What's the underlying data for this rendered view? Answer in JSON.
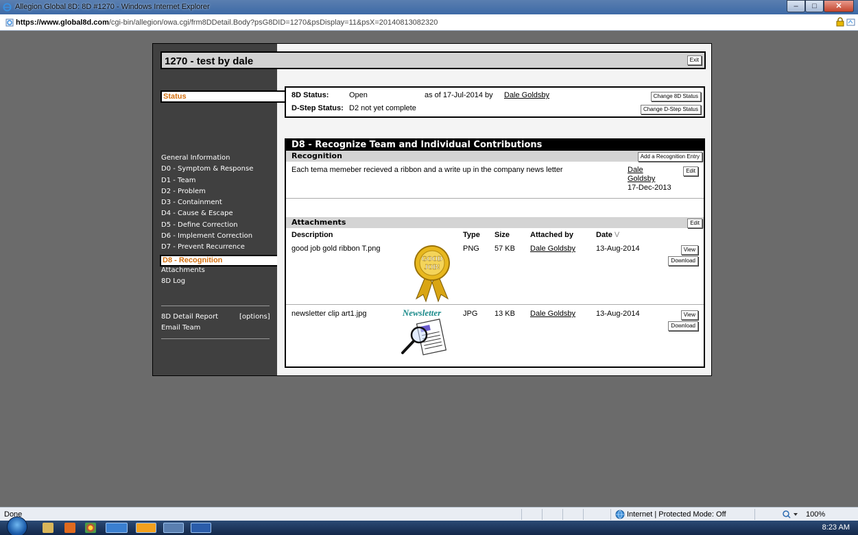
{
  "window": {
    "title": "Allegion Global 8D: 8D #1270 - Windows Internet Explorer",
    "url_host": "https://www.global8d.com",
    "url_path": "/cgi-bin/allegion/owa.cgi/frm8DDetail.Body?psG8DID=1270&psDisplay=11&psX=20140813082320"
  },
  "header": {
    "title": "1270 - test by dale",
    "exit_label": "Exit"
  },
  "status": {
    "tab_label": "Status",
    "status_label": "8D Status:",
    "status_value": "Open",
    "as_of": "as of 17-Jul-2014 by",
    "by_user": "Dale Goldsby",
    "dstep_label": "D-Step Status:",
    "dstep_value": "D2 not yet complete",
    "change_8d_label": "Change 8D Status",
    "change_dstep_label": "Change D-Step Status"
  },
  "nav": {
    "items": [
      "General Information",
      "D0 - Symptom & Response",
      "D1 - Team",
      "D2 - Problem",
      "D3 - Containment",
      "D4 - Cause & Escape",
      "D5 - Define Correction",
      "D6 - Implement Correction",
      "D7 - Prevent Recurrence",
      "D8 - Recognition",
      "Attachments",
      "8D Log"
    ],
    "report_label": "8D Detail Report",
    "options_label": "[options]",
    "email_label": "Email Team"
  },
  "d8": {
    "title": "D8 - Recognize Team and Individual Contributions",
    "recognition_header": "Recognition",
    "add_entry_label": "Add a Recognition Entry",
    "entry": {
      "text": "Each tema memeber recieved a ribbon and a write up in the company news letter",
      "user_first": "Dale",
      "user_last": "Goldsby",
      "date": "17-Dec-2013",
      "edit_label": "Edit"
    },
    "attachments_header": "Attachments",
    "attachments_edit_label": "Edit",
    "columns": {
      "description": "Description",
      "type": "Type",
      "size": "Size",
      "attached_by": "Attached by",
      "date": "Date",
      "sort": "V"
    },
    "attachments": [
      {
        "description": "good job gold ribbon T.png",
        "type": "PNG",
        "size": "57 KB",
        "attached_by": "Dale Goldsby",
        "date": "13-Aug-2014",
        "view": "View",
        "download": "Download",
        "ribbon_text_1": "GOOD",
        "ribbon_text_2": "JOB!"
      },
      {
        "description": "newsletter clip art1.jpg",
        "type": "JPG",
        "size": "13 KB",
        "attached_by": "Dale Goldsby",
        "date": "13-Aug-2014",
        "view": "View",
        "download": "Download",
        "clip_text": "Newsletter"
      }
    ]
  },
  "ie_status": {
    "left": "Done",
    "zone": "Internet | Protected Mode: Off",
    "zoom": "100%"
  },
  "taskbar": {
    "time": "8:23 AM"
  }
}
